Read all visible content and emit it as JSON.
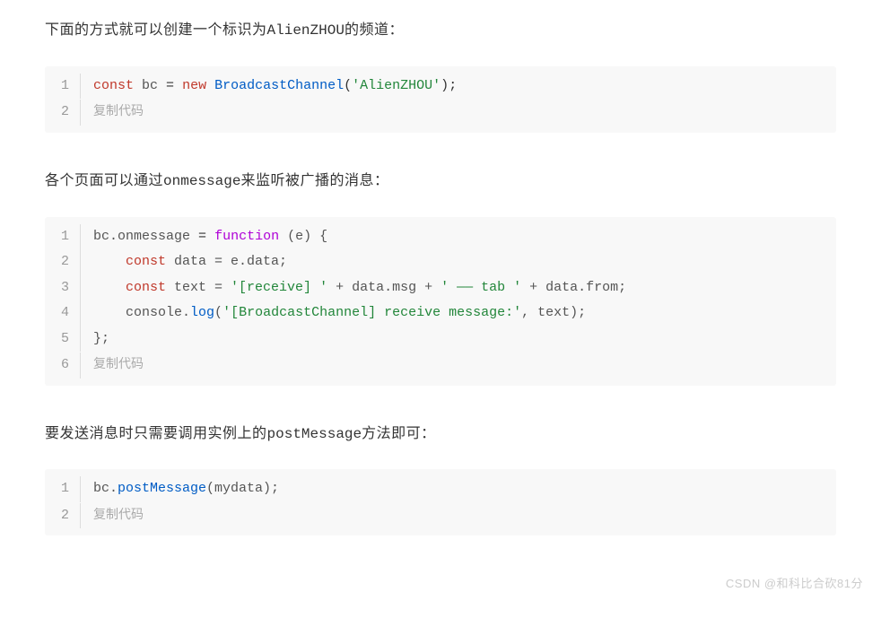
{
  "paragraphs": {
    "p1_pre": "下面的方式就可以创建一个标识为",
    "p1_code": "AlienZHOU",
    "p1_post": "的频道：",
    "p2_pre": "各个页面可以通过",
    "p2_code": "onmessage",
    "p2_post": "来监听被广播的消息：",
    "p3_pre": "要发送消息时只需要调用实例上的",
    "p3_code": "postMessage",
    "p3_post": "方法即可："
  },
  "copy_label": "复制代码",
  "code1": {
    "tokens": {
      "const": "const",
      "sp1": " bc ",
      "eq": "=",
      "sp2": " ",
      "new": "new",
      "sp3": " ",
      "class": "BroadcastChannel",
      "lp": "(",
      "str": "'AlienZHOU'",
      "rp": ")",
      "semi": ";"
    }
  },
  "code2": {
    "l1": {
      "a": "bc.onmessage ",
      "eq": "=",
      "sp": " ",
      "fn": "function",
      "b": " (e) {"
    },
    "l2": {
      "indent": "    ",
      "const": "const",
      "rest": " data = e.data;"
    },
    "l3": {
      "indent": "    ",
      "const": "const",
      "a": " text = ",
      "s1": "'[receive] '",
      "b": " + data.msg + ",
      "s2": "' —— tab '",
      "c": " + data.from;"
    },
    "l4": {
      "indent": "    console.",
      "log": "log",
      "lp": "(",
      "s1": "'[BroadcastChannel] receive message:'",
      "rest": ", text);"
    },
    "l5": {
      "a": "};"
    }
  },
  "code3": {
    "l1": {
      "a": "bc.",
      "fn": "postMessage",
      "b": "(mydata);"
    }
  },
  "watermark": "CSDN @和科比合砍81分"
}
